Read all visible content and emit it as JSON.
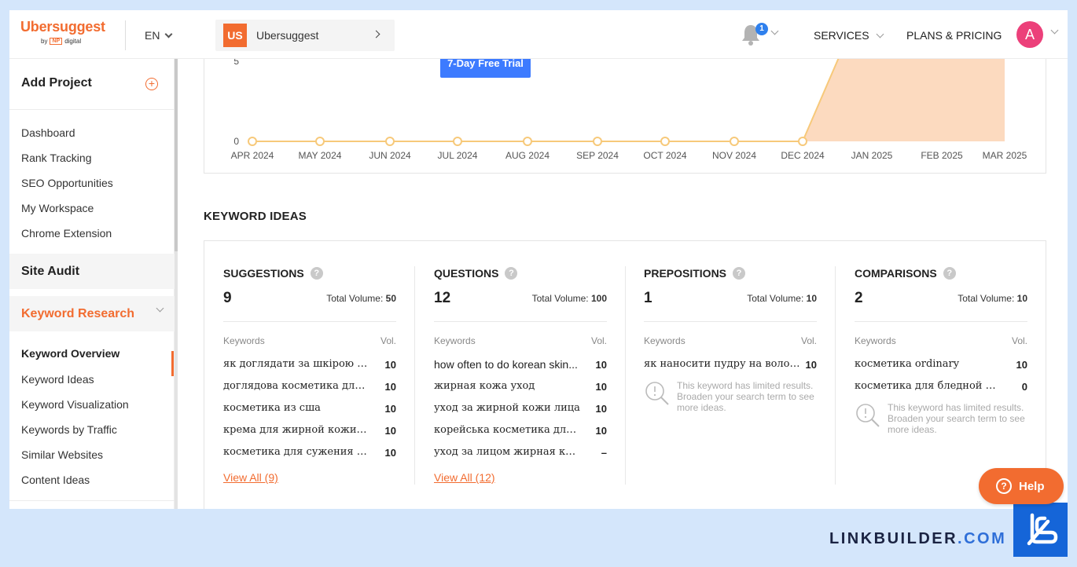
{
  "header": {
    "logo_name": "Ubersuggest",
    "logo_by": "by",
    "logo_np": "NP",
    "logo_digital": "digital",
    "language": "EN",
    "project_badge": "US",
    "project_name": "Ubersuggest",
    "notification_count": "1",
    "services_label": "SERVICES",
    "plans_label": "PLANS & PRICING",
    "avatar_letter": "A",
    "icons": [
      "bell-icon",
      "chevron-down-icon",
      "chevron-right-icon"
    ]
  },
  "sidebar": {
    "add_project": "Add Project",
    "items": [
      "Dashboard",
      "Rank Tracking",
      "SEO Opportunities",
      "My Workspace",
      "Chrome Extension"
    ],
    "site_audit": "Site Audit",
    "keyword_research": "Keyword Research",
    "kr_items": [
      "Keyword Overview",
      "Keyword Ideas",
      "Keyword Visualization",
      "Keywords by Traffic",
      "Similar Websites",
      "Content Ideas"
    ],
    "active_item": "Keyword Overview"
  },
  "trial_button": "7-Day Free Trial",
  "chart_data": {
    "type": "area",
    "categories": [
      "APR 2024",
      "MAY 2024",
      "JUN 2024",
      "JUL 2024",
      "AUG 2024",
      "SEP 2024",
      "OCT 2024",
      "NOV 2024",
      "DEC 2024",
      "JAN 2025",
      "FEB 2025",
      "MAR 2025"
    ],
    "values": [
      0,
      0,
      0,
      0,
      0,
      0,
      0,
      0,
      0,
      10,
      10,
      10
    ],
    "y_ticks": [
      "0",
      "5"
    ],
    "colors": {
      "line": "#f7c97a",
      "fill": "#fbd3b4",
      "point_fill": "#ffffff"
    }
  },
  "keyword_ideas": {
    "title": "KEYWORD IDEAS",
    "keywords_header": "Keywords",
    "vol_header": "Vol.",
    "total_volume_label": "Total Volume:",
    "limited_text": "This keyword has limited results. Broaden your search term to see more ideas.",
    "columns": [
      {
        "title": "SUGGESTIONS",
        "count": "9",
        "total_volume": "50",
        "rows": [
          {
            "kw": "як доглядати за шкірою обли...",
            "vol": "10"
          },
          {
            "kw": "доглядова косметика для жи...",
            "vol": "10"
          },
          {
            "kw": "косметика из сша",
            "vol": "10"
          },
          {
            "kw": "крема для жирной кожи лица",
            "vol": "10"
          },
          {
            "kw": "косметика для сужения пор",
            "vol": "10"
          }
        ],
        "view_all": "View All (9)"
      },
      {
        "title": "QUESTIONS",
        "count": "12",
        "total_volume": "100",
        "rows": [
          {
            "kw": "how often to do korean skin...",
            "vol": "10"
          },
          {
            "kw": "жирная кожа уход",
            "vol": "10"
          },
          {
            "kw": "уход за жирной кожи лица",
            "vol": "10"
          },
          {
            "kw": "корейська косметика для обл...",
            "vol": "10"
          },
          {
            "kw": "уход за лицом жирная кожа",
            "vol": "–"
          }
        ],
        "view_all": "View All (12)"
      },
      {
        "title": "PREPOSITIONS",
        "count": "1",
        "total_volume": "10",
        "rows": [
          {
            "kw": "як наносити пудру на волосся",
            "vol": "10"
          }
        ]
      },
      {
        "title": "COMPARISONS",
        "count": "2",
        "total_volume": "10",
        "rows": [
          {
            "kw": "косметика ordinary",
            "vol": "10"
          },
          {
            "kw": "косметика для бледной кожи",
            "vol": "0"
          }
        ]
      }
    ]
  },
  "help_label": "Help",
  "branding": {
    "name": "LINKBUILDER",
    "tld": ".COM"
  }
}
